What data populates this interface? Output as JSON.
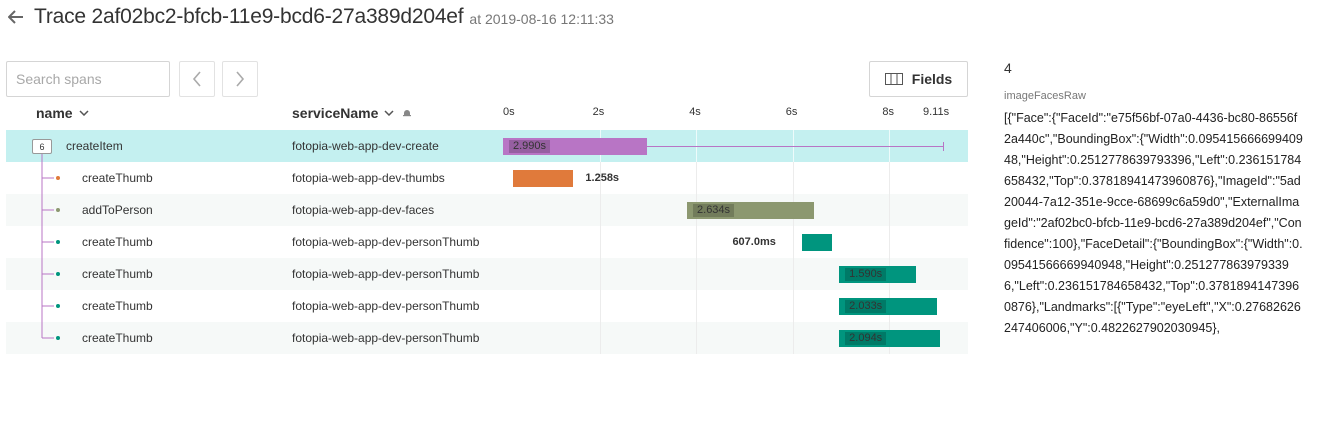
{
  "header": {
    "title": "Trace 2af02bc2-bfcb-11e9-bcd6-27a389d204ef",
    "at": "at 2019-08-16 12:11:33"
  },
  "toolbar": {
    "search_placeholder": "Search spans",
    "fields_label": "Fields"
  },
  "columns": {
    "name": "name",
    "service": "serviceName"
  },
  "timeline": {
    "ticks": [
      "0s",
      "2s",
      "4s",
      "6s",
      "8s",
      "9.11s"
    ],
    "tick_values": [
      0,
      2,
      4,
      6,
      8,
      9.11
    ],
    "total": 9.11
  },
  "colors": {
    "create": "#b875c5",
    "thumbs": "#e07a3b",
    "faces": "#8c9870",
    "personThumb": "#00957e",
    "selected_row": "#c4f0f0"
  },
  "spans": [
    {
      "name": "createItem",
      "service": "fotopia-web-app-dev-create",
      "start": 0,
      "duration": 2.99,
      "duration_label": "2.990s",
      "label_inside": true,
      "color": "#b875c5",
      "children_count": "6",
      "root": true,
      "selected": true,
      "alt": false
    },
    {
      "name": "createThumb",
      "service": "fotopia-web-app-dev-thumbs",
      "start": 0.2,
      "duration": 1.258,
      "duration_label": "1.258s",
      "label_inside": false,
      "color": "#e07a3b",
      "root": false,
      "selected": false,
      "alt": false
    },
    {
      "name": "addToPerson",
      "service": "fotopia-web-app-dev-faces",
      "start": 3.81,
      "duration": 2.634,
      "duration_label": "2.634s",
      "label_inside": true,
      "color": "#8c9870",
      "root": false,
      "selected": false,
      "alt": true
    },
    {
      "name": "createThumb",
      "service": "fotopia-web-app-dev-personThumb",
      "start": 6.2,
      "duration": 0.607,
      "duration_label": "607.0ms",
      "label_inside": false,
      "label_left": true,
      "color": "#00957e",
      "root": false,
      "selected": false,
      "alt": false
    },
    {
      "name": "createThumb",
      "service": "fotopia-web-app-dev-personThumb",
      "start": 6.96,
      "duration": 1.59,
      "duration_label": "1.590s",
      "label_inside": true,
      "color": "#00957e",
      "root": false,
      "selected": false,
      "alt": true
    },
    {
      "name": "createThumb",
      "service": "fotopia-web-app-dev-personThumb",
      "start": 6.96,
      "duration": 2.033,
      "duration_label": "2.033s",
      "label_inside": true,
      "color": "#00957e",
      "root": false,
      "selected": false,
      "alt": false
    },
    {
      "name": "createThumb",
      "service": "fotopia-web-app-dev-personThumb",
      "start": 6.96,
      "duration": 2.094,
      "duration_label": "2.094s",
      "label_inside": true,
      "color": "#00957e",
      "root": false,
      "selected": false,
      "alt": true
    }
  ],
  "detail": {
    "count": "4",
    "field_name": "imageFacesRaw",
    "field_value": "[{\"Face\":{\"FaceId\":\"e75f56bf-07a0-4436-bc80-86556f2a440c\",\"BoundingBox\":{\"Width\":0.09541566669940948,\"Height\":0.2512778639793396,\"Left\":0.236151784658432,\"Top\":0.37818941473960876},\"ImageId\":\"5ad20044-7a12-351e-9cce-68699c6a59d0\",\"ExternalImageId\":\"2af02bc0-bfcb-11e9-bcd6-27a389d204ef\",\"Confidence\":100},\"FaceDetail\":{\"BoundingBox\":{\"Width\":0.09541566669940948,\"Height\":0.2512778639793396,\"Left\":0.236151784658432,\"Top\":0.37818941473960876},\"Landmarks\":[{\"Type\":\"eyeLeft\",\"X\":0.27682626247406006,\"Y\":0.4822627902030945},"
  }
}
